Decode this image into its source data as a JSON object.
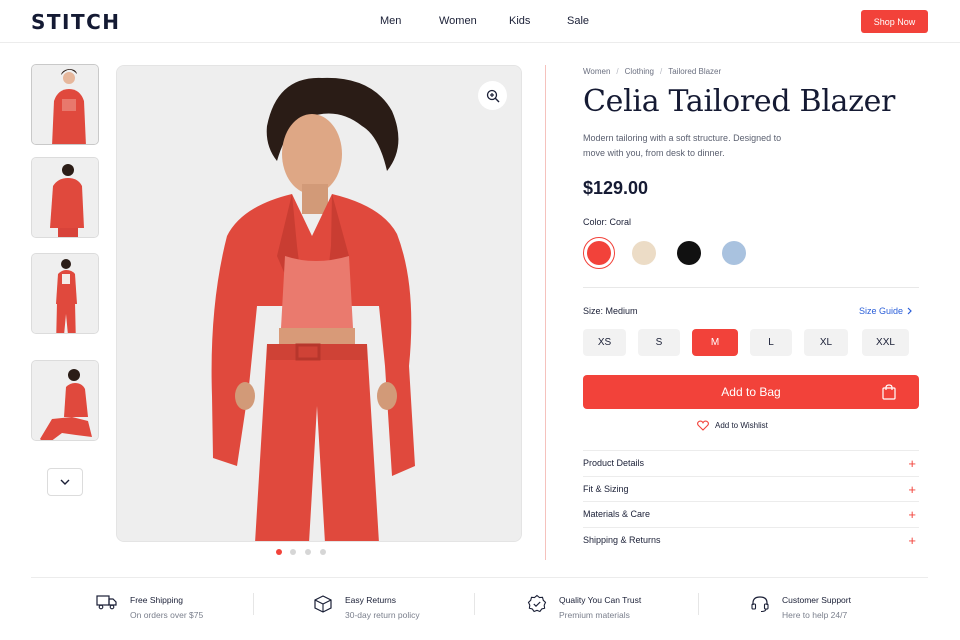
{
  "header": {
    "logo": "STITCH",
    "nav": [
      "Men",
      "Women",
      "Kids",
      "Sale"
    ],
    "cta": "Shop Now"
  },
  "gallery": {
    "thumbnails": [
      "front view",
      "back view",
      "full length",
      "seated"
    ],
    "active_thumbnail": 0,
    "dots": 4,
    "active_dot": 0,
    "zoom_icon": "zoom-in-icon"
  },
  "product": {
    "breadcrumb": [
      "Women",
      "Clothing",
      "Tailored Blazer"
    ],
    "title": "Celia Tailored Blazer",
    "description": "Modern tailoring with a soft structure. Designed to move with you, from desk to dinner.",
    "price": "$129.00",
    "color_label": "Color: Coral",
    "colors": [
      {
        "name": "Coral",
        "hex": "#f2423a",
        "selected": true
      },
      {
        "name": "Beige",
        "hex": "#ecdcc6",
        "selected": false
      },
      {
        "name": "Black",
        "hex": "#111111",
        "selected": false
      },
      {
        "name": "Blue",
        "hex": "#a9c2df",
        "selected": false
      }
    ],
    "size_label": "Size: Medium",
    "size_guide": "Size Guide",
    "sizes": [
      "XS",
      "S",
      "M",
      "L",
      "XL",
      "XXL"
    ],
    "selected_size": "M",
    "add_to_bag": "Add to Bag",
    "wishlist": "Add to Wishlist",
    "accordion": [
      "Product Details",
      "Fit & Sizing",
      "Materials & Care",
      "Shipping & Returns"
    ]
  },
  "features": [
    {
      "title": "Free Shipping",
      "subtitle": "On orders over $75",
      "icon": "truck-icon"
    },
    {
      "title": "Easy Returns",
      "subtitle": "30-day return policy",
      "icon": "box-icon"
    },
    {
      "title": "Quality You Can Trust",
      "subtitle": "Premium materials",
      "icon": "badge-icon"
    },
    {
      "title": "Customer Support",
      "subtitle": "Here to help 24/7",
      "icon": "headset-icon"
    }
  ],
  "theme": {
    "accent": "#f2423a",
    "link": "#2b5fd9",
    "text": "#1a1f36"
  }
}
